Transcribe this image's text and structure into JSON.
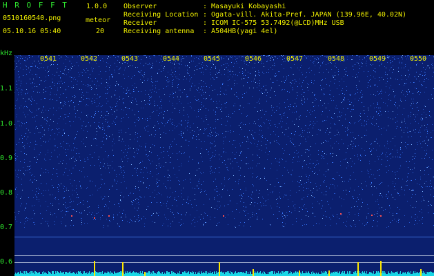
{
  "header": {
    "app_title": "H R O F F T",
    "version": "1.0.0",
    "filename": "0510160540.png",
    "meteor_label": "meteor",
    "meteor_count": "20",
    "datetime": "05.10.16 05:40",
    "info_labels": [
      "Observer",
      "Receiving Location",
      "Receiver",
      "Receiving antenna"
    ],
    "info_values": [
      ": Masayuki Kobayashi",
      ": Ogata-vill. Akita-Pref. JAPAN (139.96E, 40.02N)",
      ": ICOM IC-575 53.7492(@LCD)MHz USB",
      ": A504HB(yagi 4el)"
    ]
  },
  "spectrogram": {
    "y_unit": "kHz",
    "y_ticks": [
      "1.1",
      "1.0",
      "0.9",
      "0.8",
      "0.7",
      "0.6"
    ],
    "time_ticks": [
      "0541",
      "0542",
      "0543",
      "0544",
      "0545",
      "0546",
      "0547",
      "0548",
      "0549",
      "0550"
    ],
    "colors": {
      "background": "#0b1f6e",
      "noise": "#3a7bff",
      "cyan": "#19d7e6",
      "meteor": "#ffe800"
    }
  }
}
